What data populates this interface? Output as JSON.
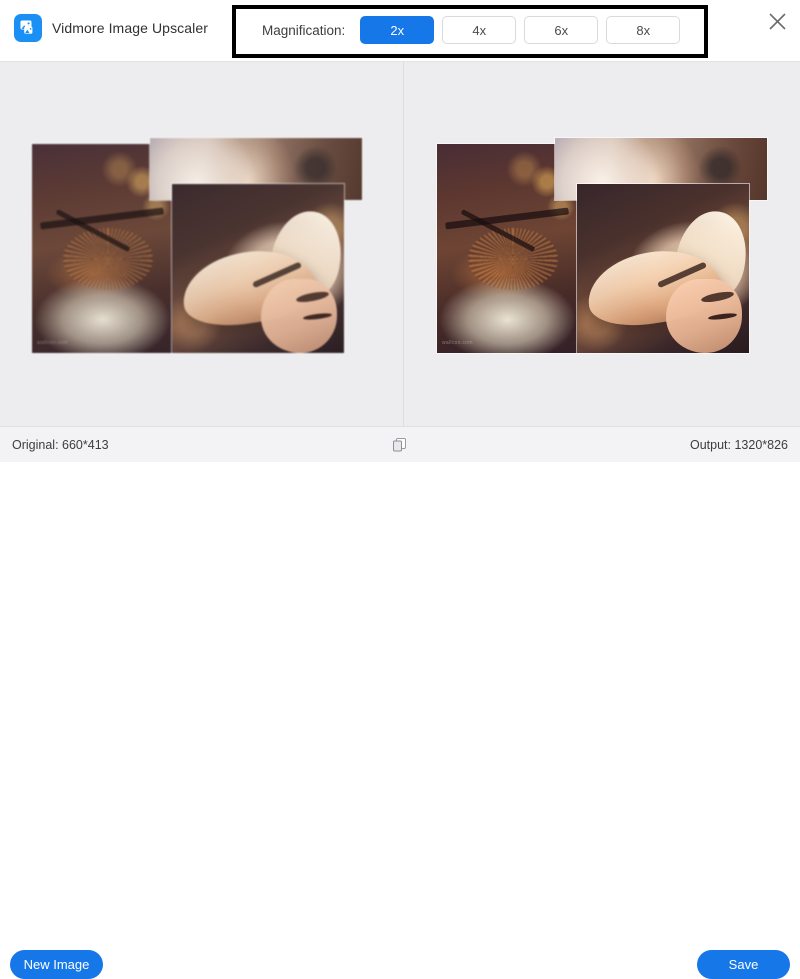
{
  "app": {
    "title": "Vidmore Image Upscaler",
    "logo_icon": "image-upscaler-logo-icon",
    "close_icon": "close-icon",
    "accent_color": "#1677e8",
    "background_color": "#ededef"
  },
  "magnification": {
    "label": "Magnification:",
    "selected": "2x",
    "options": [
      {
        "label": "2x",
        "active": true
      },
      {
        "label": "4x",
        "active": false
      },
      {
        "label": "6x",
        "active": false
      },
      {
        "label": "8x",
        "active": false
      }
    ]
  },
  "preview": {
    "left_pane": {
      "name": "original-preview",
      "watermark": "wallcoo.com"
    },
    "right_pane": {
      "name": "upscaled-preview",
      "watermark": "wallcoo.com"
    }
  },
  "status": {
    "original": "Original: 660*413",
    "output": "Output: 1320*826",
    "compare_icon": "compare-overlay-icon"
  },
  "actions": {
    "new_image": "New Image",
    "save": "Save"
  }
}
